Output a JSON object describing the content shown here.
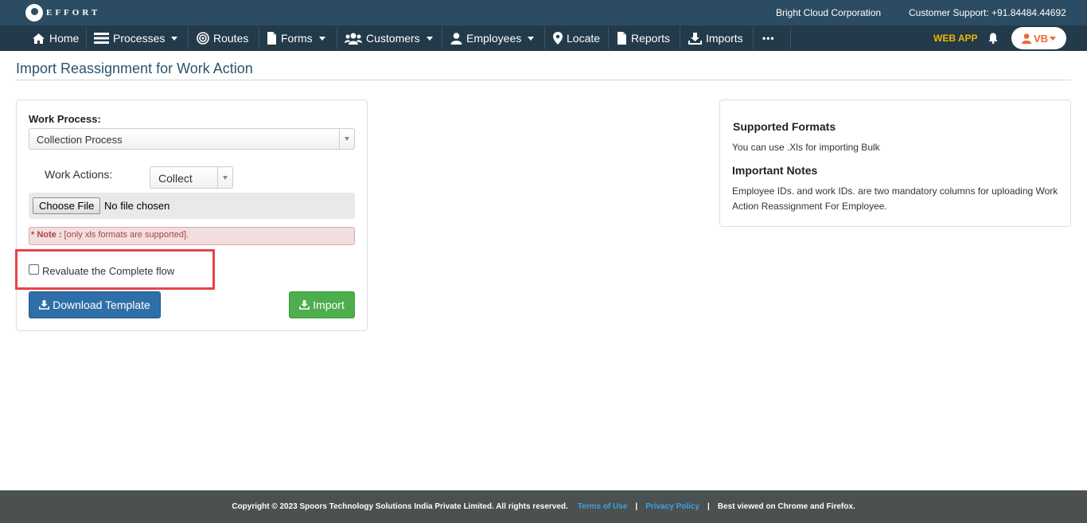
{
  "brand": {
    "logo_text": "EFFORT"
  },
  "header": {
    "org_name": "Bright Cloud Corporation",
    "support": "Customer Support: +91.84484.44692"
  },
  "nav": {
    "items": [
      {
        "label": "Home",
        "icon": "home-icon"
      },
      {
        "label": "Processes",
        "icon": "processes-icon",
        "dropdown": true
      },
      {
        "label": "Routes",
        "icon": "target-icon"
      },
      {
        "label": "Forms",
        "icon": "document-icon",
        "dropdown": true
      },
      {
        "label": "Customers",
        "icon": "users-icon",
        "dropdown": true
      },
      {
        "label": "Employees",
        "icon": "user-icon",
        "dropdown": true
      },
      {
        "label": "Locate",
        "icon": "map-pin-icon"
      },
      {
        "label": "Reports",
        "icon": "document-icon"
      },
      {
        "label": "Imports",
        "icon": "download-icon"
      }
    ],
    "more": "•••",
    "web_app": "WEB APP",
    "user_initials": "VB"
  },
  "page": {
    "title": "Import Reassignment for Work Action"
  },
  "form": {
    "work_process_label": "Work Process:",
    "work_process_value": "Collection Process",
    "work_actions_label": "Work Actions:",
    "work_action_value": "Collect",
    "file_button": "Choose File",
    "file_status": "No file chosen",
    "note_prefix": "* Note :",
    "note_text": " [only xls formats are supported].",
    "revaluate_label": "Revaluate the Complete flow",
    "revaluate_checked": false,
    "download_button": "Download Template",
    "import_button": "Import"
  },
  "info": {
    "formats_title": "Supported Formats",
    "formats_text": "You can use .Xls for importing Bulk",
    "notes_title": "Important Notes",
    "notes_text": "Employee IDs. and work IDs. are two mandatory columns for uploading Work Action Reassignment For Employee."
  },
  "footer": {
    "copyright": "Copyright © 2023 Spoors Technology Solutions India Private Limited. All rights reserved.",
    "terms": "Terms of Use",
    "privacy": "Privacy Policy",
    "browsers": "Best viewed on Chrome and Firefox.",
    "separator": "|"
  },
  "colors": {
    "topbar": "#2b4c63",
    "navbar": "#233a4b",
    "primary_button": "#2f6fa8",
    "success_button": "#4cae4c",
    "highlight": "#e8434a",
    "web_app": "#f0b400",
    "user": "#f0692d",
    "footer": "#4a5150"
  }
}
